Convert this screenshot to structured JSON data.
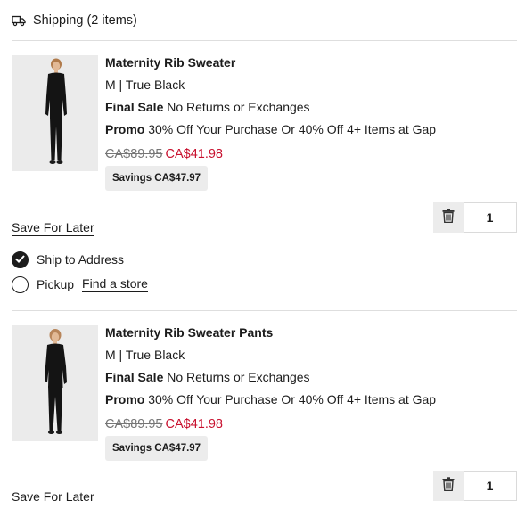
{
  "header": {
    "title": "Shipping (2 items)",
    "icon": "truck-icon"
  },
  "items": [
    {
      "name": "Maternity Rib Sweater",
      "variant": "M | True Black",
      "final_label": "Final Sale",
      "final_text": "No Returns or Exchanges",
      "promo_label": "Promo",
      "promo_text": "30% Off Your Purchase Or 40% Off 4+ Items at Gap",
      "original_price": "CA$89.95",
      "sale_price": "CA$41.98",
      "savings": "Savings CA$47.97",
      "quantity": "1",
      "save_for_later": "Save For Later"
    },
    {
      "name": "Maternity Rib Sweater Pants",
      "variant": "M | True Black",
      "final_label": "Final Sale",
      "final_text": "No Returns or Exchanges",
      "promo_label": "Promo",
      "promo_text": "30% Off Your Purchase Or 40% Off 4+ Items at Gap",
      "original_price": "CA$89.95",
      "sale_price": "CA$41.98",
      "savings": "Savings CA$47.97",
      "quantity": "1",
      "save_for_later": "Save For Later"
    }
  ],
  "fulfillment": {
    "ship_label": "Ship to Address",
    "ship_selected": true,
    "pickup_label": "Pickup",
    "find_store": "Find a store"
  },
  "colors": {
    "sale_price": "#c8102e",
    "original_price": "#767676",
    "savings_bg": "#ececec",
    "divider": "#dedede"
  }
}
